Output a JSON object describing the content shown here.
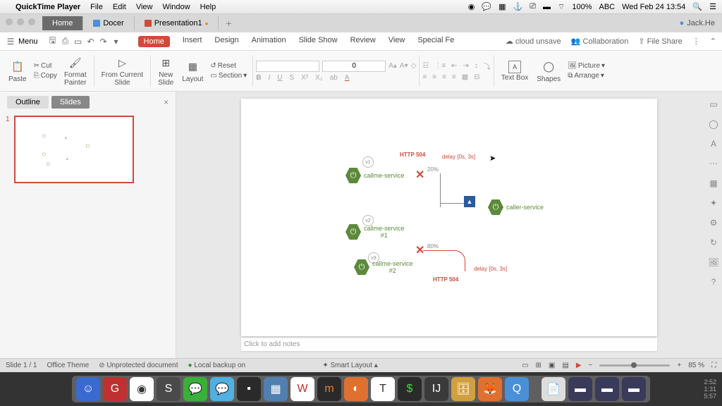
{
  "menubar": {
    "app": "QuickTime Player",
    "items": [
      "File",
      "Edit",
      "View",
      "Window",
      "Help"
    ],
    "right": {
      "battery": "100%",
      "ime": "ABC",
      "datetime": "Wed Feb 24 13:54"
    }
  },
  "window": {
    "tabs": [
      {
        "label": "Home",
        "active": true
      },
      {
        "label": "Docer",
        "icon": "blue"
      },
      {
        "label": "Presentation1",
        "icon": "red",
        "dirty": true
      }
    ],
    "user": "Jack.He"
  },
  "ribbon": {
    "menuLabel": "Menu",
    "tabs": [
      "Home",
      "Insert",
      "Design",
      "Animation",
      "Slide Show",
      "Review",
      "View",
      "Special Fe"
    ],
    "activeTab": "Home",
    "right": [
      "cloud unsave",
      "Collaboration",
      "File Share"
    ]
  },
  "toolbar": {
    "paste": "Paste",
    "cut": "Cut",
    "copy": "Copy",
    "formatPainter": "Format\nPainter",
    "fromCurrentSlide": "From Current\nSlide",
    "newSlide": "New\nSlide",
    "layout": "Layout",
    "reset": "Reset",
    "section": "Section",
    "fontSize": "0",
    "textBox": "Text Box",
    "shapes": "Shapes",
    "picture": "Picture",
    "arrange": "Arrange"
  },
  "sidebar": {
    "tabs": [
      "Outline",
      "Slides"
    ],
    "activeTab": "Slides",
    "slideNum": "1"
  },
  "slide": {
    "httpTop": "HTTP 504",
    "httpBottom": "HTTP 504",
    "delayTop": "delay [0s, 3s]",
    "delayBottom": "delay [0s, 3s]",
    "pctTop": "20%",
    "pctBottom": "80%",
    "svc1": "callme-service",
    "svc2": "callme-service\n#1",
    "svc3": "callme-service\n#2",
    "caller": "caller-service",
    "v1": "v1",
    "v2": "v2",
    "v3": "v3"
  },
  "notes": "Click to add notes",
  "status": {
    "slide": "Slide 1 / 1",
    "theme": "Office Theme",
    "doc": "Unprotected document",
    "backup": "Local backup on",
    "smart": "Smart Layout",
    "zoom": "85 %"
  },
  "dock": {
    "times": [
      "2:52",
      "1:31",
      "5:57"
    ]
  }
}
